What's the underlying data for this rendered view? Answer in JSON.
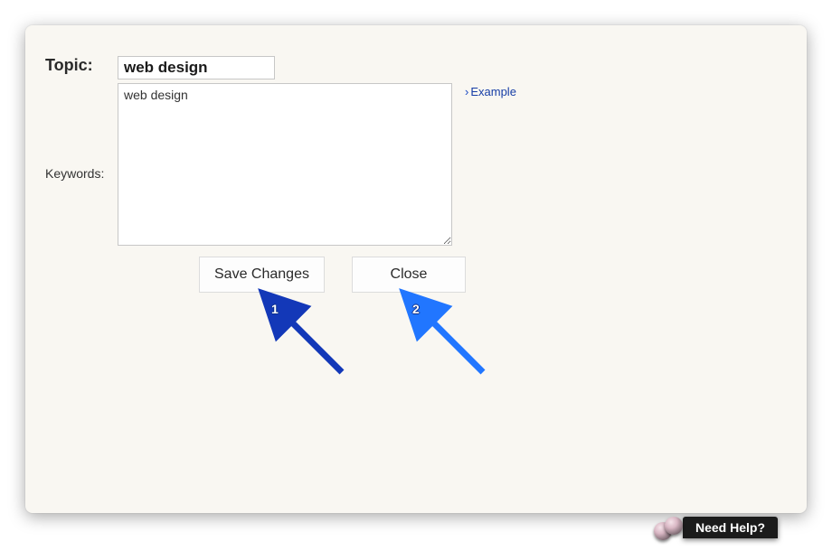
{
  "form": {
    "topic_label": "Topic:",
    "topic_value": "web design",
    "keywords_label": "Keywords:",
    "keywords_value": "web design",
    "example_link": "Example"
  },
  "buttons": {
    "save": "Save Changes",
    "close": "Close"
  },
  "annotations": {
    "arrow1_number": "1",
    "arrow2_number": "2"
  },
  "help_widget": {
    "label": "Need Help?"
  }
}
